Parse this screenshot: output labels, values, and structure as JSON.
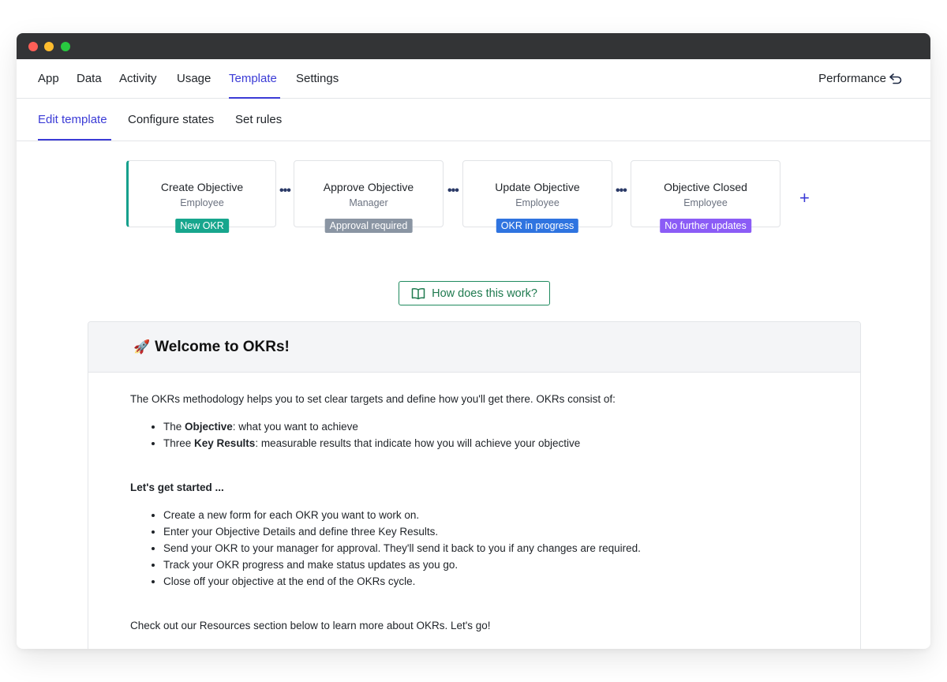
{
  "nav": {
    "items": [
      "App",
      "Data",
      "Activity",
      "Usage",
      "Template",
      "Settings"
    ],
    "active": "Template",
    "right_label": "Performance",
    "right_icon": "undo-arrow-icon"
  },
  "subnav": {
    "items": [
      "Edit template",
      "Configure states",
      "Set rules"
    ],
    "active": "Edit template"
  },
  "states": [
    {
      "title": "Create Objective",
      "role": "Employee",
      "badge": "New OKR",
      "badge_color": "#17a68d"
    },
    {
      "title": "Approve Objective",
      "role": "Manager",
      "badge": "Approval required",
      "badge_color": "#8a95a3"
    },
    {
      "title": "Update Objective",
      "role": "Employee",
      "badge": "OKR in progress",
      "badge_color": "#2f74e0"
    },
    {
      "title": "Objective Closed",
      "role": "Employee",
      "badge": "No further updates",
      "badge_color": "#8b5cf6"
    }
  ],
  "connector": "•••",
  "add_label": "+",
  "help_button": {
    "label": "How does this work?",
    "icon": "open-book-icon"
  },
  "welcome": {
    "icon": "🚀",
    "title": "Welcome to OKRs!",
    "intro": "The OKRs methodology helps you to set clear targets and define how you'll get there. OKRs consist of:",
    "bullets": [
      {
        "prefix": "The ",
        "bold": "Objective",
        "rest": ": what you want to achieve"
      },
      {
        "prefix": "Three ",
        "bold": "Key Results",
        "rest": ": measurable results that indicate how you will achieve your objective"
      }
    ],
    "started_heading": "Let's get started ...",
    "steps": [
      "Create a new form for each OKR you want to work on.",
      "Enter your Objective Details and define three Key Results.",
      "Send your OKR to your manager for approval. They'll send it back to you if any changes are required.",
      "Track your OKR progress and make status updates as you go.",
      "Close off your objective at the end of the OKRs cycle."
    ],
    "outro": "Check out our Resources section below to learn more about OKRs. Let's go!"
  },
  "colors": {
    "accent": "#3b3bd6",
    "first_state_bar": "#16a08c",
    "help_button": "#1f7a4f"
  }
}
